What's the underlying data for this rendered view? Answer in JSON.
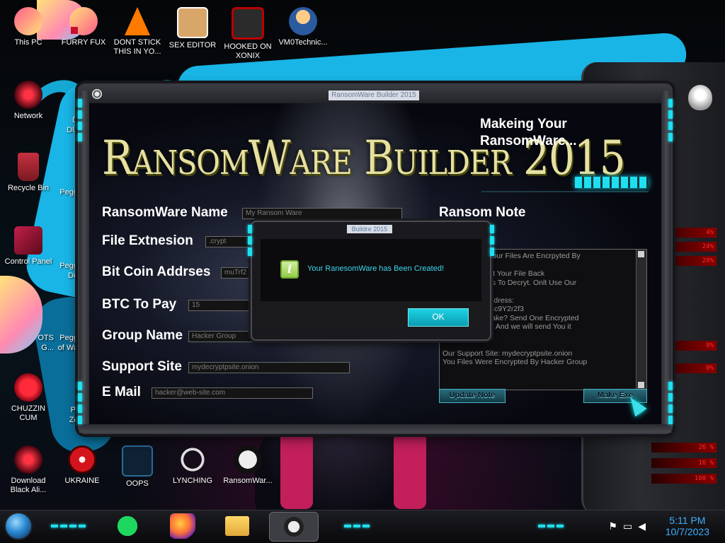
{
  "desktop": {
    "icons": [
      {
        "label": "This PC"
      },
      {
        "label": "FURRY FUX"
      },
      {
        "label": "DONT STICK THIS IN YO..."
      },
      {
        "label": "SEX EDITOR"
      },
      {
        "label": "HOOKED ON XONIX"
      },
      {
        "label": "VM0Technic..."
      },
      {
        "label": "Network"
      },
      {
        "label": "Recycle Bin"
      },
      {
        "label": "Control Panel"
      },
      {
        "label": "CHUZZIN CUM"
      },
      {
        "label": "Download Black Ali..."
      },
      {
        "label": "UKRAINE"
      },
      {
        "label": "OOPS"
      },
      {
        "label": "LYNCHING"
      },
      {
        "label": "RansomWar..."
      }
    ],
    "clipped_labels": [
      "D",
      "DU",
      "Pegg",
      "Pegg",
      "De",
      "Pegg",
      "of Wa",
      "PI",
      "Zc",
      "OTS",
      "G..."
    ]
  },
  "gadget": {
    "rows": [
      "4%",
      "24%",
      "28%",
      "8%",
      "0%",
      "26 %",
      "16 %",
      "100 %"
    ]
  },
  "builder": {
    "window_title": "RansomWare Builder 2015",
    "logo_text": "RansomWare Builder 2015",
    "status_heading": "Makeing Your RansomWare...",
    "progress_fraction": 0.44,
    "labels": {
      "name": "RansomWare Name",
      "extension": "File Extnesion",
      "btc_address": "Bit Coin Addrses",
      "btc_pay": "BTC To Pay",
      "group": "Group Name",
      "support": "Support Site",
      "email": "E Mail",
      "note": "Ransom Note"
    },
    "values": {
      "name": "My Ransom Ware",
      "extension": ".crypt",
      "btc_address": "muTrf2",
      "btc_pay": "15",
      "group": "Hacker Group",
      "support": "mydecryptpsite.onion",
      "email": "hacker@web-site.com"
    },
    "note_lines": [
      "So Sorry. But Your Files Are Encrpyted By",
      "are",
      "ry! You Can Get Your File Back",
      "Use Other Tools To Decryt. Onlt Use Our",
      "",
      "Our Bit Coin Address:",
      "opS9TY4fEoU4c9Y2r2f3",
      "ous We Aere Fake? Send One Encrypted",
      "@web-site.com And we will send You it",
      "",
      "",
      "Our Support Site: mydecryptpsite.onion",
      "You Files Were Encrypted By Hacker Group"
    ],
    "buttons": {
      "update": "Update Note",
      "make": "Make Exe"
    }
  },
  "dialog": {
    "title": "Buildre 2015",
    "message": "Your RanesomWare has Been Created!",
    "ok_label": "OK"
  },
  "taskbar": {
    "time": "5:11 PM",
    "date": "10/7/2023"
  },
  "colors": {
    "accent_cyan": "#1ee0f0",
    "dialog_text": "#3fd6f0",
    "logo_gold": "#e6e0a2",
    "clock_blue": "#3fb0ff"
  }
}
